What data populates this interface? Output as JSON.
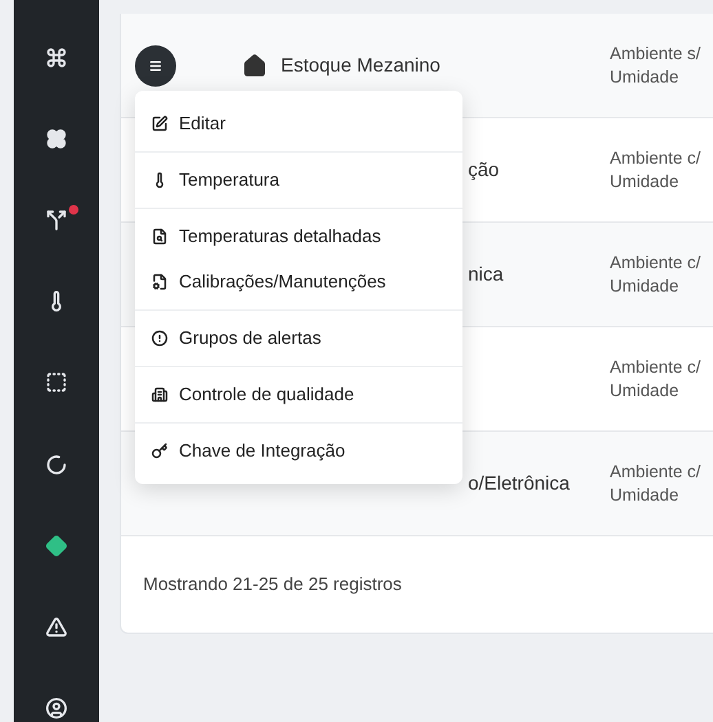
{
  "table": {
    "rows": [
      {
        "name": "Estoque Mezanino",
        "type_line_1": "Ambiente s/",
        "type_line_2": "Umidade"
      },
      {
        "name": "ção",
        "type_line_1": "Ambiente c/",
        "type_line_2": "Umidade"
      },
      {
        "name": "nica",
        "type_line_1": "Ambiente c/",
        "type_line_2": "Umidade"
      },
      {
        "type_line_1": "Ambiente c/",
        "type_line_2": "Umidade"
      },
      {
        "name": "o/Eletrônica",
        "type_line_1": "Ambiente c/",
        "type_line_2": "Umidade"
      }
    ],
    "footer": "Mostrando 21-25 de 25 registros"
  },
  "sidebar": {
    "items": [
      {
        "kind": "command",
        "badge": false,
        "active": false
      },
      {
        "kind": "flower",
        "badge": false,
        "active": false
      },
      {
        "kind": "route",
        "badge": true,
        "active": false
      },
      {
        "kind": "thermometer",
        "badge": false,
        "active": false
      },
      {
        "kind": "square",
        "badge": false,
        "active": false
      },
      {
        "kind": "ring",
        "badge": false,
        "active": false
      },
      {
        "kind": "diamond",
        "badge": false,
        "active": true
      },
      {
        "kind": "warning",
        "badge": false,
        "active": false
      },
      {
        "kind": "user",
        "badge": false,
        "active": false
      }
    ]
  },
  "menu": {
    "sections": [
      [
        {
          "kind": "edit",
          "label": "Editar"
        }
      ],
      [
        {
          "kind": "thermometer",
          "label": "Temperatura"
        }
      ],
      [
        {
          "kind": "file-search",
          "label": "Temperaturas detalhadas"
        },
        {
          "kind": "file-gear",
          "label": "Calibrações/Manutenções"
        }
      ],
      [
        {
          "kind": "alert",
          "label": "Grupos de alertas"
        }
      ],
      [
        {
          "kind": "building",
          "label": "Controle de qualidade"
        }
      ],
      [
        {
          "kind": "key",
          "label": "Chave de Integração"
        }
      ]
    ]
  }
}
